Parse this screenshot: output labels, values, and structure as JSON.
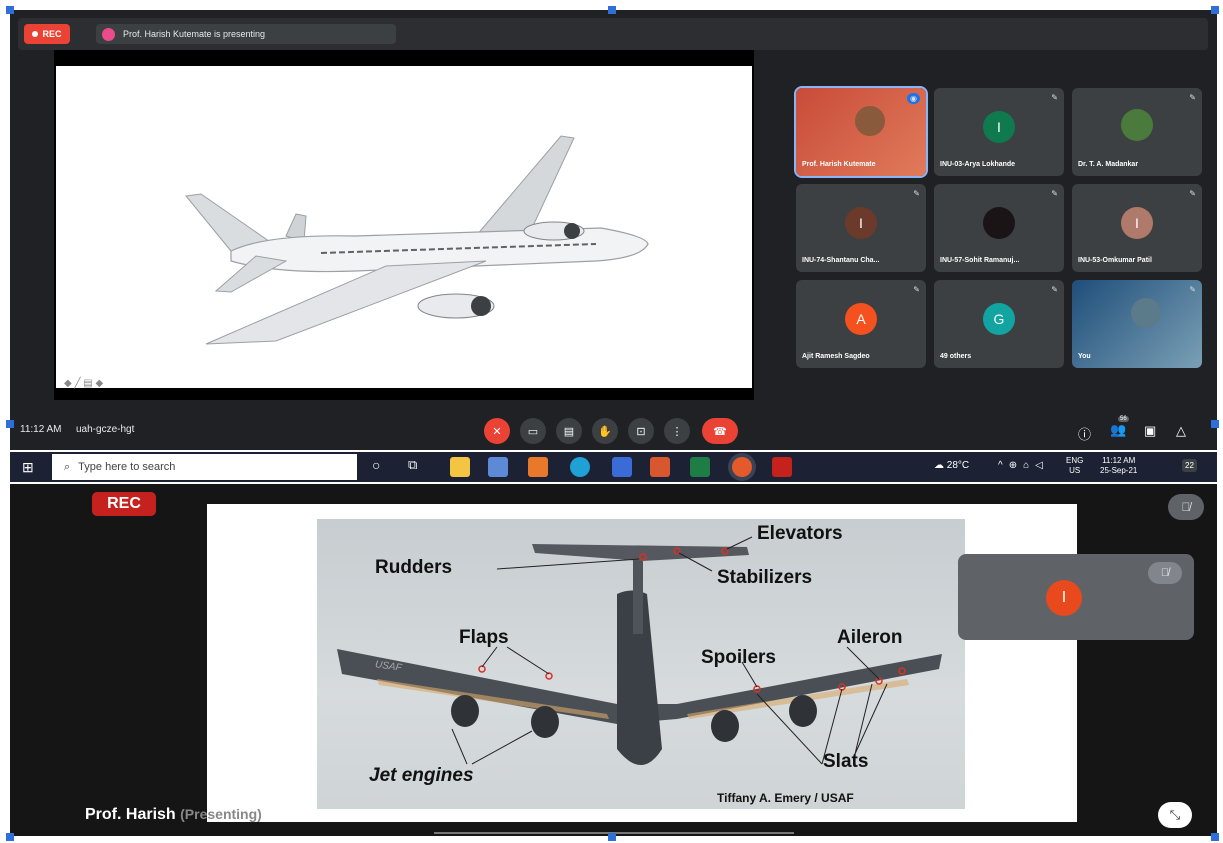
{
  "meet": {
    "rec_label": "REC",
    "presenting_text": "Prof. Harish Kutemate is presenting",
    "slide_controls": "◆ ╱ ▤ ◆",
    "tiles": [
      {
        "name": "Prof. Harish Kutemate",
        "type": "video",
        "avatar_letter": "",
        "avatar_color": "#8a5a3c"
      },
      {
        "name": "INU-03-Arya Lokhande",
        "type": "avatar",
        "avatar_letter": "I",
        "avatar_color": "#0f7a4d"
      },
      {
        "name": "Dr. T. A. Madankar",
        "type": "photo",
        "avatar_letter": "",
        "avatar_color": "#4a7a3c"
      },
      {
        "name": "INU-74-Shantanu Cha...",
        "type": "avatar",
        "avatar_letter": "I",
        "avatar_color": "#6b3a2a"
      },
      {
        "name": "INU-57-Sohit Ramanuj...",
        "type": "avatar",
        "avatar_letter": "",
        "avatar_color": "#1a1416"
      },
      {
        "name": "INU-53-Omkumar Patil",
        "type": "avatar",
        "avatar_letter": "I",
        "avatar_color": "#b07a6a"
      },
      {
        "name": "Ajit Ramesh Sagdeo",
        "type": "avatar",
        "avatar_letter": "A",
        "avatar_color": "#f4511e"
      },
      {
        "name": "49 others",
        "type": "group",
        "avatar_letter": "G",
        "avatar_color": "#12a4a0"
      },
      {
        "name": "You",
        "type": "video",
        "avatar_letter": "",
        "avatar_color": "#5b7a8a"
      }
    ],
    "time": "11:12 AM",
    "meeting_code": "uah-gcze-hgt",
    "participant_count": "56"
  },
  "taskbar": {
    "search_placeholder": "Type here to search",
    "weather": "28°C",
    "lang_top": "ENG",
    "lang_bottom": "US",
    "clock_time": "11:12 AM",
    "clock_date": "25-Sep-21",
    "notifications": "22"
  },
  "meet2": {
    "rec_label": "REC",
    "labels": {
      "elevators": "Elevators",
      "rudders": "Rudders",
      "stabilizers": "Stabilizers",
      "flaps": "Flaps",
      "aileron": "Aileron",
      "spoilers": "Spoilers",
      "jet_engines": "Jet engines",
      "slats": "Slats",
      "credit": "Tiffany A. Emery / USAF",
      "tail_marking": "USAF"
    },
    "self_avatar_letter": "I",
    "presenter_label": "Prof. Harish",
    "presenter_overlay": "(Presenting)"
  },
  "colors": {
    "meet_bg": "#202124",
    "rec_red": "#ea4335",
    "end_call": "#ea4335",
    "taskbar_bg": "#1c2233"
  }
}
